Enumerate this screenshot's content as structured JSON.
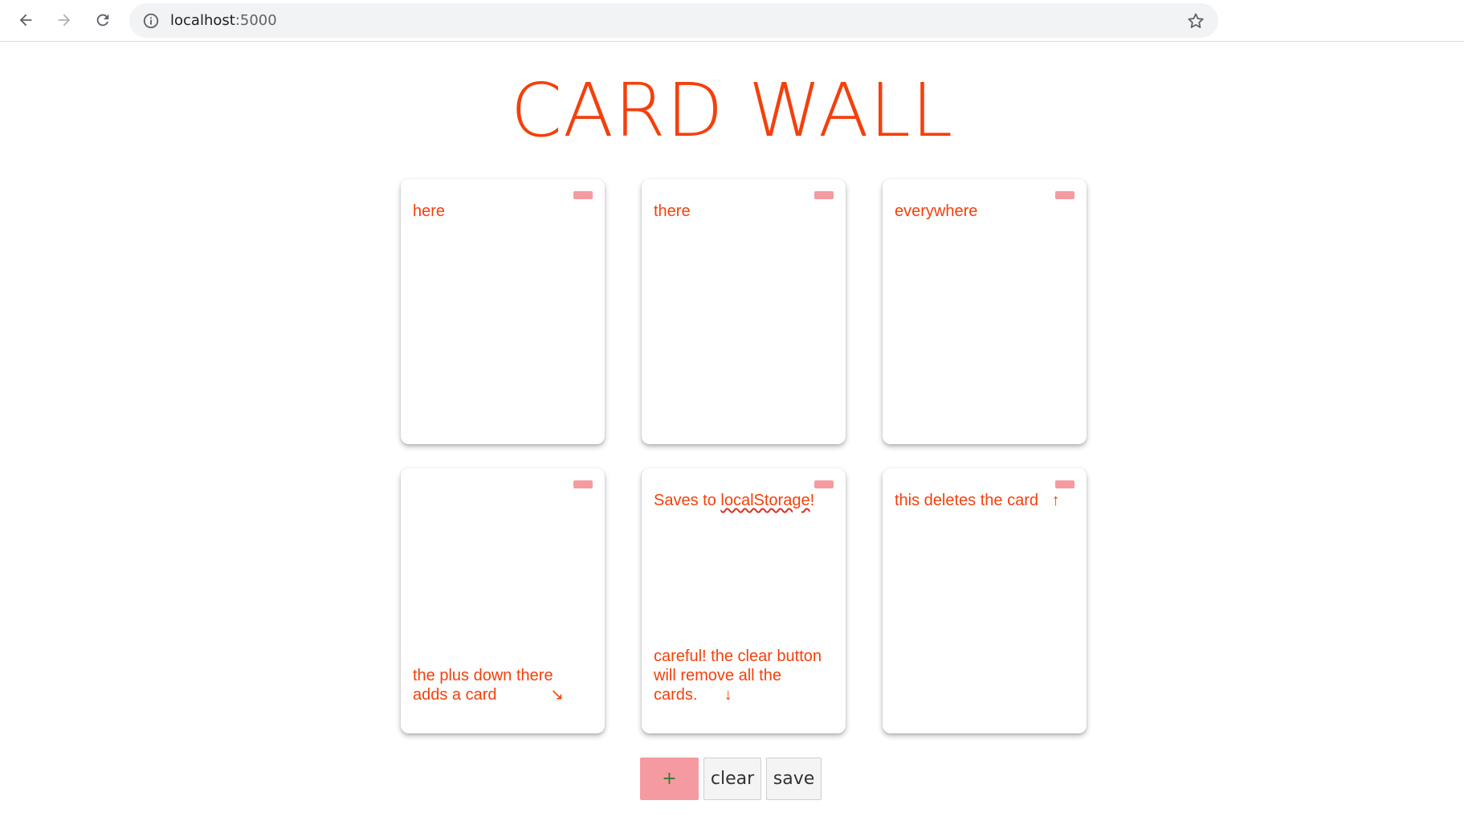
{
  "browser": {
    "url_host": "localhost",
    "url_port": ":5000"
  },
  "page": {
    "title": "CARD WALL"
  },
  "cards": [
    {
      "top_text": "here",
      "bottom_text": ""
    },
    {
      "top_text": "there",
      "bottom_text": ""
    },
    {
      "top_text": "everywhere",
      "bottom_text": ""
    },
    {
      "top_text": "",
      "bottom_text": "the plus down there\nadds a card            ↘"
    },
    {
      "top_text_before": "Saves to ",
      "top_text_link": "localStorage",
      "top_text_after": "!",
      "bottom_text": "careful! the clear button\nwill remove all the\ncards.      ↓"
    },
    {
      "top_text": "this deletes the card   ↑",
      "bottom_text": ""
    }
  ],
  "controls": {
    "add_label": "+",
    "clear_label": "clear",
    "save_label": "save"
  },
  "colors": {
    "accent": "#f4400c",
    "pink": "#f59aa1"
  }
}
